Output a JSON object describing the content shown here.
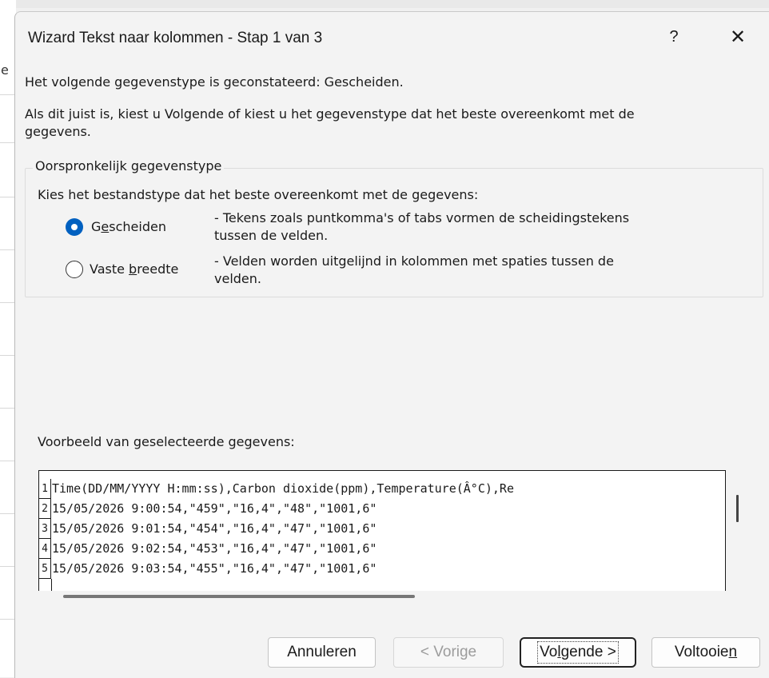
{
  "background": {
    "cell_char": "e"
  },
  "window": {
    "title": "Wizard Tekst naar kolommen - Stap 1 van 3",
    "help": "?",
    "close": "✕"
  },
  "intro": {
    "detected": "Het volgende gegevenstype is geconstateerd: Gescheiden.",
    "instruction_line1": "Als dit juist is, kiest u Volgende of kiest u het gegevenstype dat het beste overeenkomt met de",
    "instruction_line2": "gegevens."
  },
  "original_type": {
    "group_title": "Oorspronkelijk gegevenstype",
    "prompt": "Kies het bestandstype dat het beste overeenkomt met de gegevens:",
    "options": [
      {
        "label_pre": "G",
        "label_mnemonic": "e",
        "label_post": "scheiden",
        "selected": true,
        "desc_line1": "- Tekens zoals puntkomma's of tabs vormen de scheidingstekens",
        "desc_line2": "tussen de velden."
      },
      {
        "label_pre": "Vaste ",
        "label_mnemonic": "b",
        "label_post": "reedte",
        "selected": false,
        "desc_line1": "- Velden worden uitgelijnd in kolommen met spaties tussen de",
        "desc_line2": "velden."
      }
    ]
  },
  "preview": {
    "label": "Voorbeeld van geselecteerde gegevens:",
    "rows": [
      {
        "num": "1",
        "text": "Time(DD/MM/YYYY H:mm:ss),Carbon dioxide(ppm),Temperature(Â°C),Re"
      },
      {
        "num": "2",
        "text": "15/05/2026 9:00:54,\"459\",\"16,4\",\"48\",\"1001,6\""
      },
      {
        "num": "3",
        "text": "15/05/2026 9:01:54,\"454\",\"16,4\",\"47\",\"1001,6\""
      },
      {
        "num": "4",
        "text": "15/05/2026 9:02:54,\"453\",\"16,4\",\"47\",\"1001,6\""
      },
      {
        "num": "5",
        "text": "15/05/2026 9:03:54,\"455\",\"16,4\",\"47\",\"1001,6\""
      }
    ]
  },
  "buttons": {
    "cancel": "Annuleren",
    "back": "< Vorige",
    "next_pre": "Vo",
    "next_mnemonic": "l",
    "next_post": "gende >",
    "finish_pre": "Voltooie",
    "finish_mnemonic": "n"
  },
  "colors": {
    "accent": "#0060c0",
    "dialog_bg": "#f3f3f3",
    "disabled_text": "#9c9c9c"
  }
}
